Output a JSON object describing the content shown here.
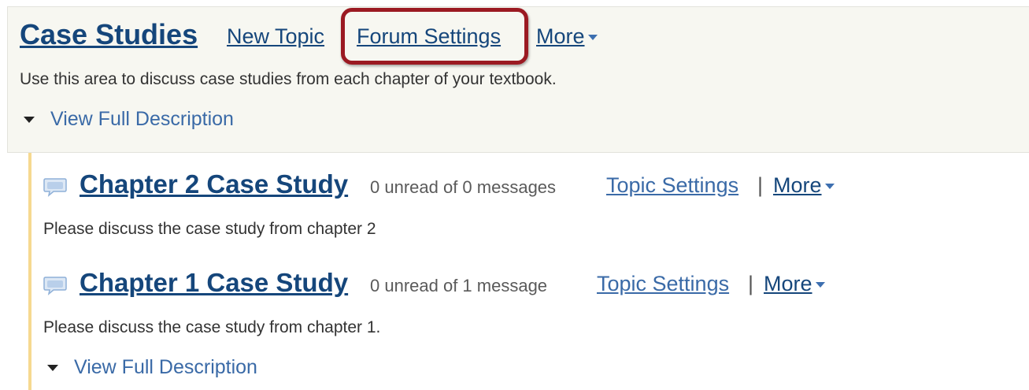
{
  "forum": {
    "title": "Case Studies",
    "links": {
      "new_topic": "New Topic",
      "forum_settings": "Forum Settings",
      "more": "More"
    },
    "description": "Use this area to discuss case studies from each chapter of your textbook.",
    "toggle_label": "View Full Description",
    "highlight_color": "#9b1a22"
  },
  "topics": [
    {
      "icon": "speech-bubble-icon",
      "title": "Chapter 2 Case Study",
      "count": "0 unread of 0 messages",
      "settings_label": "Topic Settings",
      "separator": "|",
      "more_label": "More",
      "description": "Please discuss the case study from chapter 2"
    },
    {
      "icon": "speech-bubble-icon",
      "title": "Chapter 1 Case Study",
      "count": "0 unread of 1 message",
      "settings_label": "Topic Settings",
      "separator": "|",
      "more_label": "More",
      "description": "Please discuss the case study from chapter 1.",
      "toggle_label": "View Full Description"
    }
  ],
  "colors": {
    "link": "#15467b",
    "panel_bg": "#f7f7f1",
    "topic_rule": "#f6d990"
  }
}
